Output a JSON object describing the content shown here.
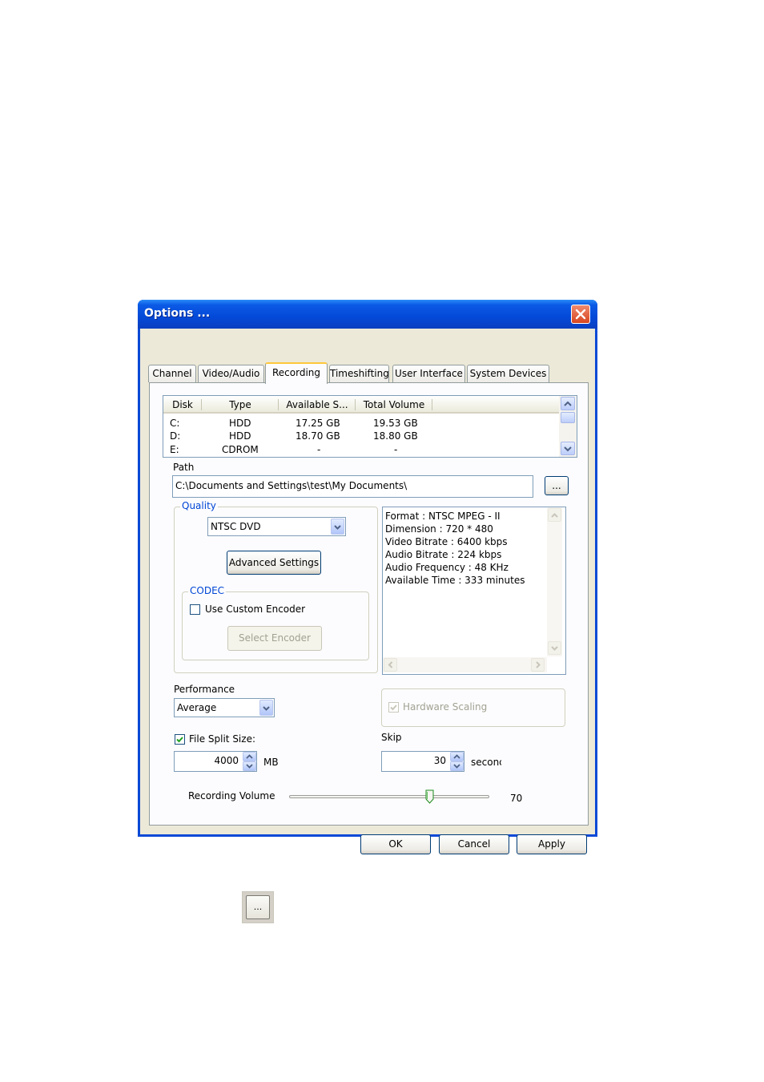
{
  "window": {
    "title": "Options ...",
    "tabs": [
      "Channel",
      "Video/Audio",
      "Recording",
      "Timeshifting",
      "User Interface",
      "System Devices"
    ],
    "active_tab": "Recording"
  },
  "disks": {
    "columns": [
      "Disk",
      "Type",
      "Available S...",
      "Total Volume"
    ],
    "rows": [
      [
        "C:",
        "HDD",
        "17.25 GB",
        "19.53 GB"
      ],
      [
        "D:",
        "HDD",
        "18.70 GB",
        "18.80 GB"
      ],
      [
        "E:",
        "CDROM",
        "-",
        "-"
      ]
    ]
  },
  "path": {
    "label": "Path",
    "value": "C:\\Documents and Settings\\test\\My Documents\\",
    "browse_label": "..."
  },
  "quality": {
    "legend": "Quality",
    "selected": "NTSC DVD",
    "advanced_button": "Advanced Settings",
    "info_lines": [
      "Format : NTSC MPEG - II",
      "Dimension : 720 * 480",
      "Video Bitrate : 6400 kbps",
      "Audio Bitrate : 224 kbps",
      "Audio Frequency : 48 KHz",
      "Available Time : 333 minutes"
    ]
  },
  "codec": {
    "legend": "CODEC",
    "use_custom_label": "Use Custom Encoder",
    "use_custom_checked": false,
    "select_button": "Select Encoder"
  },
  "performance": {
    "label": "Performance",
    "selected": "Average"
  },
  "hardware_scaling": {
    "label": "Hardware Scaling",
    "checked": true,
    "enabled": false
  },
  "file_split": {
    "label": "File Split Size:",
    "checked": true,
    "value": "4000",
    "unit": "MB"
  },
  "skip": {
    "label": "Skip",
    "value": "30",
    "unit": "seconc"
  },
  "recording_volume": {
    "label": "Recording Volume",
    "value": "70",
    "level": 0.7
  },
  "buttons": {
    "ok": "OK",
    "cancel": "Cancel",
    "apply": "Apply"
  },
  "standalone_browse": "..."
}
